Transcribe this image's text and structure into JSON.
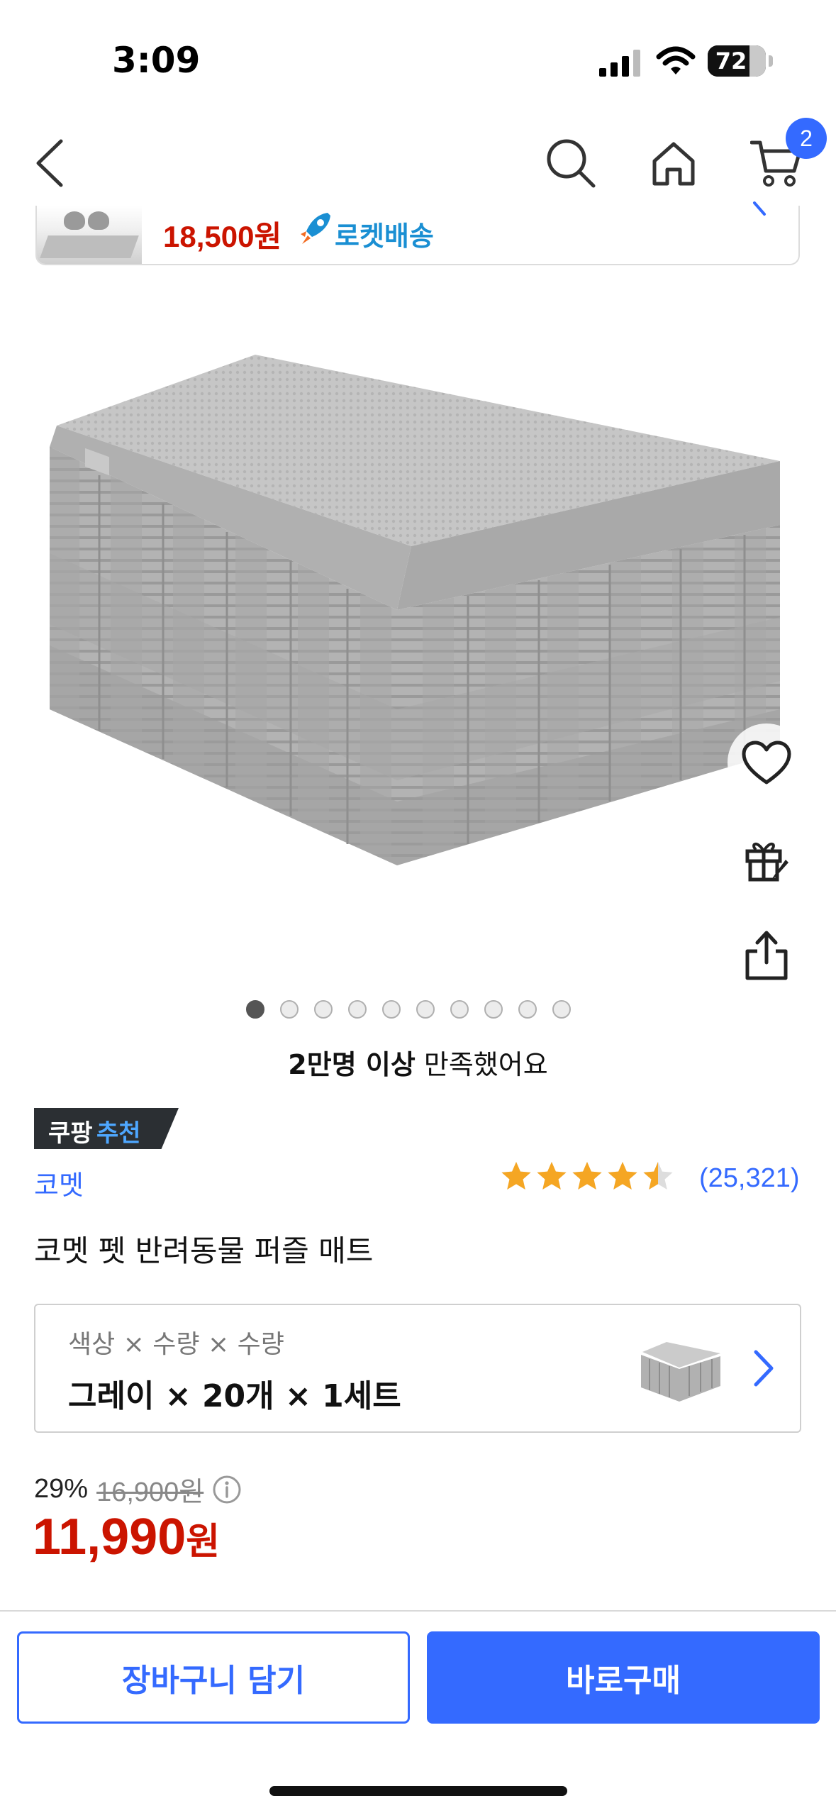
{
  "status_bar": {
    "time": "3:09",
    "battery": "72",
    "battery_level": 0.72
  },
  "nav": {
    "cart_count": "2"
  },
  "promo": {
    "price": "18,500원",
    "delivery": "로켓배송"
  },
  "carousel": {
    "total": 10,
    "active_index": 0
  },
  "satisfaction": {
    "bold": "2만명 이상",
    "rest": " 만족했어요"
  },
  "badge": {
    "part1": "쿠팡",
    "part2": "추천"
  },
  "product": {
    "brand": "코멧",
    "title": "코멧 펫 반려동물 퍼즐 매트",
    "rating": 4.5,
    "rating_count": "(25,321)"
  },
  "option": {
    "label": "색상 × 수량 × 수량",
    "value": "그레이 × 20개 × 1세트"
  },
  "price": {
    "discount": "29%",
    "original": "16,900원",
    "sale": "11,990",
    "sale_unit": "원"
  },
  "bottom": {
    "cart_button": "장바구니 담기",
    "buy_button": "바로구매"
  },
  "colors": {
    "accent": "#346aff",
    "price_red": "#cb1400",
    "star": "#f5a623",
    "rocket": "#1a8fd3"
  }
}
